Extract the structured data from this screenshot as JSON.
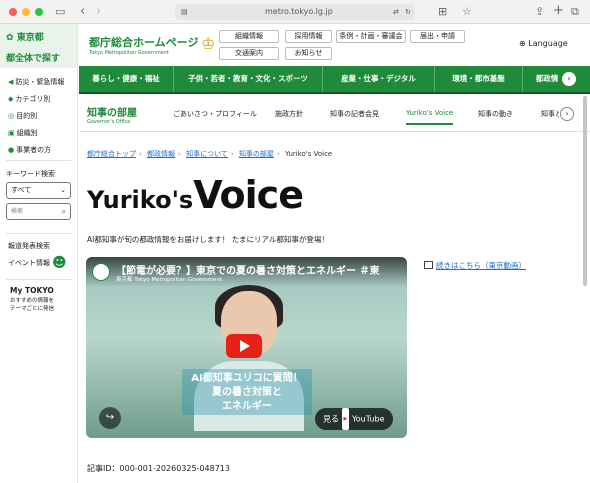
{
  "browser": {
    "url": "metro.tokyo.lg.jp",
    "colors": {
      "close": "#ff5f57",
      "minimize": "#febc2e",
      "maximize": "#28c840"
    }
  },
  "sidebar": {
    "logo": "東京都",
    "tagline": "都全体で探す",
    "items": [
      {
        "icon": "megaphone-icon",
        "label": "防災・緊急情報"
      },
      {
        "icon": "tag-icon",
        "label": "カテゴリ別"
      },
      {
        "icon": "target-icon",
        "label": "目的別"
      },
      {
        "icon": "org-icon",
        "label": "組織別"
      },
      {
        "icon": "person-icon",
        "label": "事業者の方"
      }
    ],
    "keyword_label": "キーワード検索",
    "select_value": "すべて",
    "search_placeholder": "検索",
    "bottom_items": [
      "報道発表検索",
      "イベント情報"
    ],
    "mytokyo_title": "My TOKYO",
    "mytokyo_text": "おすすめの情報を\nテーマごとに発信"
  },
  "header": {
    "site_title": "都庁総合ホームページ",
    "site_subtitle": "Tokyo Metropolitan Government",
    "buttons": [
      "組織情報",
      "採用情報",
      "条例・計画・審議会",
      "届出・申請",
      "交通案内",
      "お知らせ"
    ],
    "language_label": "Language"
  },
  "global_nav": {
    "items": [
      "暮らし・健康・福祉",
      "子供・若者・教育・文化・スポーツ",
      "産業・仕事・デジタル",
      "環境・都市基盤",
      "都政情"
    ],
    "color": "#1e8a3a"
  },
  "sub_nav": {
    "title": "知事の部屋",
    "title_en": "Governor's Office",
    "items": [
      "ごあいさつ・プロフィール",
      "施政方針",
      "知事の記者会見",
      "Yuriko's Voice",
      "知事の動き",
      "知事と"
    ],
    "active": "Yuriko's Voice"
  },
  "breadcrumb": [
    "都庁総合トップ",
    "都政情報",
    "知事について",
    "知事の部屋",
    "Yuriko's Voice"
  ],
  "page": {
    "title_left": "Yuriko's",
    "title_right": "Voice",
    "intro": "AI都知事が旬の都政情報をお届けします！ たまにリアル都知事が登場！",
    "more_link": "続きはこちら（東京動画）",
    "article_id": "記事ID：000-001-20260325-048713"
  },
  "video": {
    "title": "【節電が必要？】東京での夏の暑さ対策とエネルギー ＃東",
    "channel": "東京都 Tokyo Metropolitan Government",
    "caption_lines": [
      "AI都知事ユリコに質問！",
      "夏の暑さ対策と",
      "エネルギー"
    ],
    "watch_on": "見る",
    "youtube": "YouTube"
  }
}
